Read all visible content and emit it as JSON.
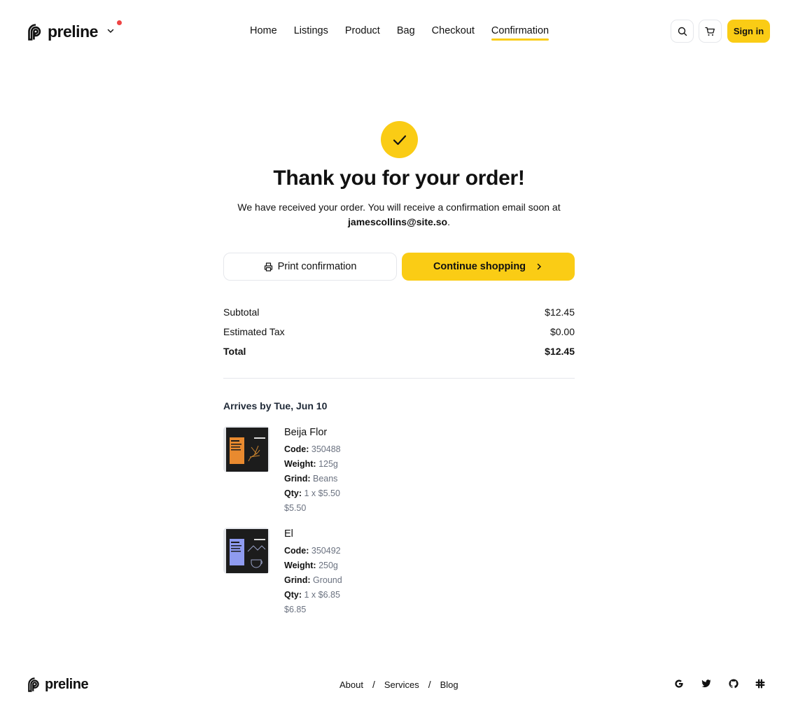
{
  "brand": {
    "name": "preline"
  },
  "nav": {
    "items": [
      "Home",
      "Listings",
      "Product",
      "Bag",
      "Checkout",
      "Confirmation"
    ],
    "active": "Confirmation"
  },
  "header": {
    "signin_label": "Sign in"
  },
  "confirmation": {
    "title": "Thank you for your order!",
    "message": "We have received your order. You will receive a confirmation email soon at",
    "email": "jamescollins@site.so",
    "print_label": "Print confirmation",
    "continue_label": "Continue shopping"
  },
  "summary": {
    "subtotal_label": "Subtotal",
    "subtotal": "$12.45",
    "tax_label": "Estimated Tax",
    "tax": "$0.00",
    "total_label": "Total",
    "total": "$12.45"
  },
  "shipping": {
    "arrives": "Arrives by Tue, Jun 10"
  },
  "items": [
    {
      "name": "Beija Flor",
      "code_label": "Code:",
      "code": "350488",
      "weight_label": "Weight:",
      "weight": "125g",
      "grind_label": "Grind:",
      "grind": "Beans",
      "qty_label": "Qty:",
      "qty": "1 x $5.50",
      "price": "$5.50",
      "label_color": "#e98a2f"
    },
    {
      "name": "El",
      "code_label": "Code:",
      "code": "350492",
      "weight_label": "Weight:",
      "weight": "250g",
      "grind_label": "Grind:",
      "grind": "Ground",
      "qty_label": "Qty:",
      "qty": "1 x $6.85",
      "price": "$6.85",
      "label_color": "#8f9bf0"
    }
  ],
  "footer": {
    "links": [
      "About",
      "Services",
      "Blog"
    ],
    "separator": "/"
  },
  "colors": {
    "accent": "#facc15",
    "notification": "#ef4444"
  }
}
